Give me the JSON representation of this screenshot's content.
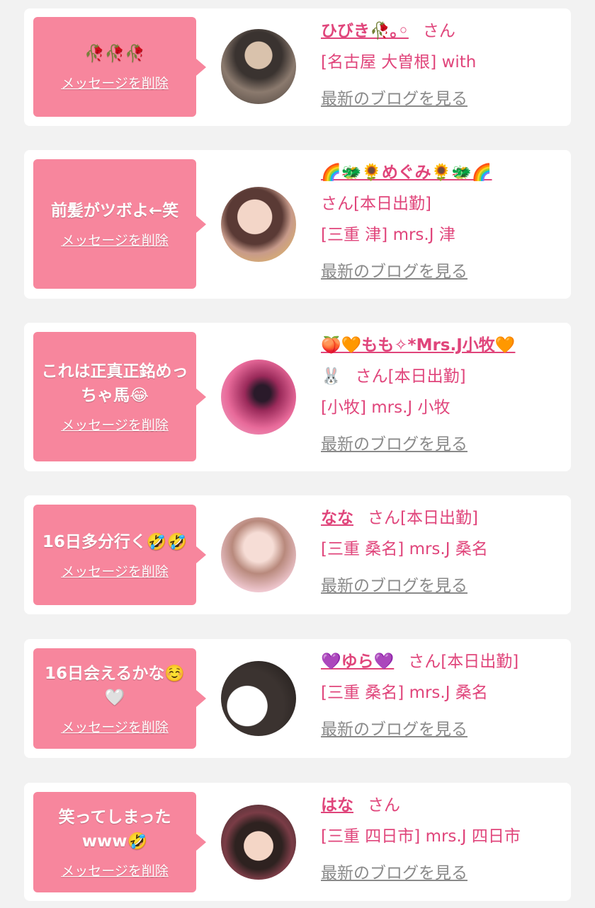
{
  "delete_label": "メッセージを削除",
  "blog_label": "最新のブログを見る",
  "cards": [
    {
      "message": "🥀🥀🥀",
      "name": "ひびき🥀｡◦",
      "suffix": "さん",
      "location": "[名古屋 大曽根] with"
    },
    {
      "message": "前髪がツボよ←笑",
      "name": "🌈🐲🌻めぐみ🌻🐲🌈",
      "suffix": "さん[本日出勤]",
      "location": "[三重 津] mrs.J 津"
    },
    {
      "message": "これは正真正銘めっちゃ馬😂",
      "name": "🍑🧡もも✧*Mrs.J小牧🧡",
      "name_extra": "🐰",
      "suffix": "さん[本日出勤]",
      "location": "[小牧] mrs.J 小牧"
    },
    {
      "message": "16日多分行く🤣🤣",
      "name": "なな",
      "suffix": "さん[本日出勤]",
      "location": "[三重 桑名] mrs.J 桑名"
    },
    {
      "message": "16日会えるかな☺️🤍",
      "name": "💜ゆら💜",
      "suffix": "さん[本日出勤]",
      "location": "[三重 桑名] mrs.J 桑名"
    },
    {
      "message": "笑ってしまったwww🤣",
      "name": "はな",
      "suffix": "さん",
      "location": "[三重 四日市] mrs.J 四日市"
    }
  ]
}
